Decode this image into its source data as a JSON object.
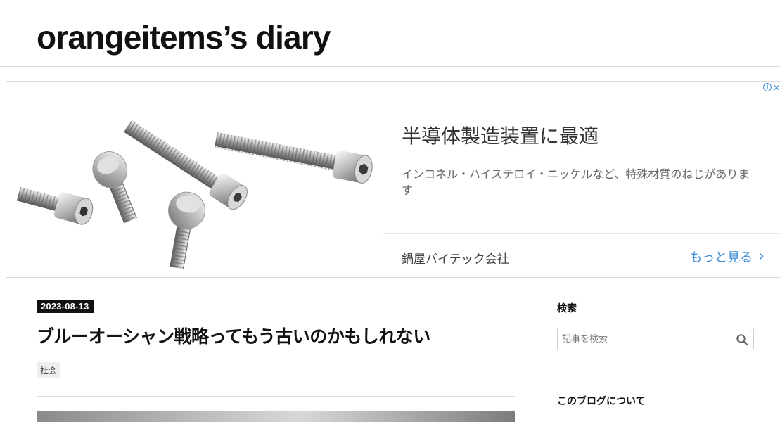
{
  "site": {
    "title": "orangeitems’s diary"
  },
  "ad": {
    "headline": "半導体製造装置に最適",
    "description": "インコネル・ハイステロイ・ニッケルなど、特殊材質のねじがあります",
    "advertiser": "鍋屋バイテック会社",
    "more_label": "もっと見る",
    "info_icon": "i",
    "close_icon": "✕",
    "image_icon": "socket-head-bolts-photo"
  },
  "entry": {
    "date": "2023-08-13",
    "title": "ブルーオーシャン戦略ってもう古いのかもしれない",
    "category": "社会"
  },
  "sidebar": {
    "search_title": "検索",
    "search_placeholder": "記事を検索",
    "about_title": "このブログについて"
  },
  "colors": {
    "link": "#3f8fd8",
    "badge_bg": "#111111"
  }
}
